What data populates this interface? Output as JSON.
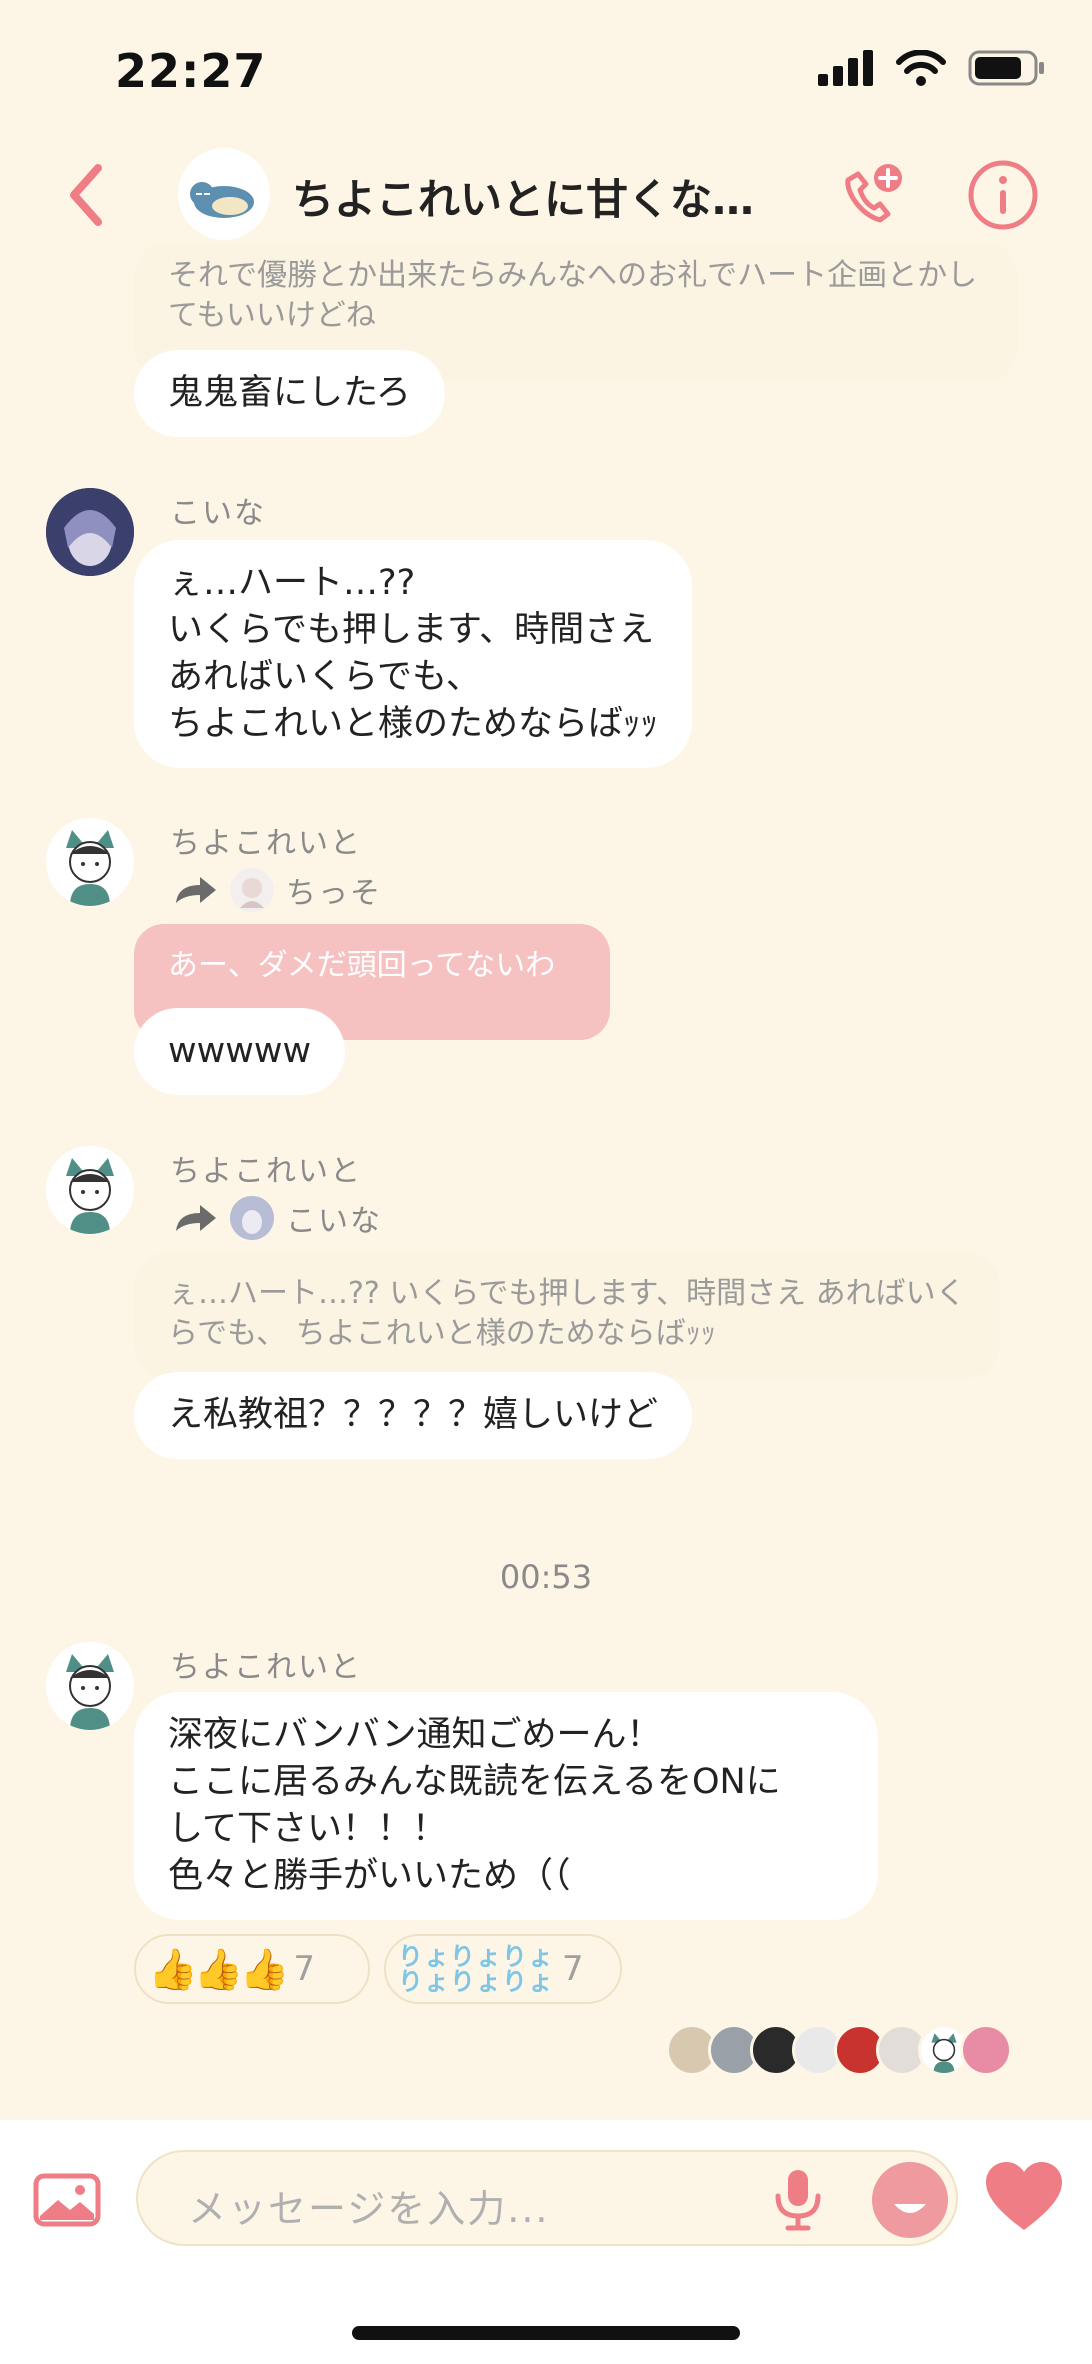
{
  "status": {
    "time": "22:27"
  },
  "header": {
    "title": "ちよこれいとに甘くな…"
  },
  "messages": {
    "m1_quote": "それで優勝とか出来たらみんなへのお礼でハート企画とかしてもいいけどね",
    "m1_text": "鬼鬼畜にしたろ",
    "m2_sender": "こいな",
    "m2_lines": [
      "ぇ…ハート…??",
      "いくらでも押します、時間さえ",
      "あればいくらでも、",
      "ちよこれいと様のためならばｯｯ"
    ],
    "m3_sender": "ちよこれいと",
    "m3_fwd_name": "ちっそ",
    "m3_quote": "あー、ダメだ頭回ってないわ",
    "m3_text": "wwwww",
    "m4_sender": "ちよこれいと",
    "m4_fwd_name": "こいな",
    "m4_quote": "ぇ…ハート…?? いくらでも押します、時間さえ あればいくらでも、 ちよこれいと様のためならばｯｯ",
    "m4_text": "え私教祖？？？？？嬉しいけど",
    "time_sep": "00:53",
    "m5_sender": "ちよこれいと",
    "m5_lines": [
      "深夜にバンバン通知ごめーん！",
      "ここに居るみんな既読を伝えるをONに",
      "して下さい！！！",
      "色々と勝手がいいため（（"
    ]
  },
  "reactions": [
    {
      "icon": "thumbs-up-icon",
      "emoji": "👍👍👍",
      "count": "7"
    },
    {
      "icon": "ryoryo-stamp-icon",
      "text_top": "りょりょりょ",
      "text_bottom": "りょりょりょ",
      "count": "7"
    }
  ],
  "input": {
    "placeholder": "メッセージを入力..."
  },
  "colors": {
    "background": "#fdf6e6",
    "accent": "#ee7d86",
    "quote_pink": "#f6c1c1"
  }
}
